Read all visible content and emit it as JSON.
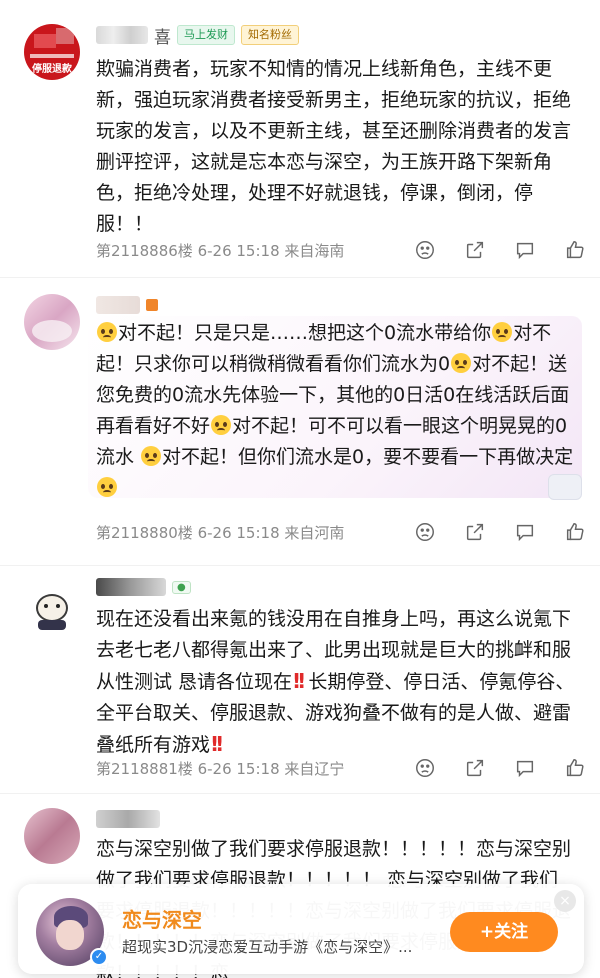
{
  "comments": [
    {
      "name_tail": "喜",
      "badges": [
        "马上发财",
        "知名粉丝"
      ],
      "text": "欺骗消费者，玩家不知情的情况上线新角色，主线不更新，强迫玩家消费者接受新男主，拒绝玩家的抗议，拒绝玩家的发言，以及不更新主线，甚至还删除消费者的发言删评控评，这就是忘本恋与深空，为王族开路下架新角色，拒绝冷处理，处理不好就退钱，停课，倒闭，停服！！",
      "meta": "第2118886楼  6-26 15:18  来自海南",
      "avatar_text": "停服退款"
    },
    {
      "parts": [
        "对不起！只是只是……想把这个0流水带给你",
        "对不起！只求你可以稍微稍微看看你们流水为0",
        "对不起！送您免费的0流水先体验一下，其他的0日活0在线活跃后面再看看好不好",
        "对不起！可不可以看一眼这个明晃晃的0流水 ",
        "对不起！但你们流水是0，要不要看一下再做决定"
      ],
      "meta": "第2118880楼  6-26 15:18  来自河南"
    },
    {
      "text_a": "现在还没看出来氪的钱没用在自推身上吗，再这么说氪下去老七老八都得氪出来了、此男出现就是巨大的挑衅和服从性测试 恳请各位现在",
      "text_b": "长期停登、停日活、停氪停谷、全平台取关、停服退款、游戏狗叠不做有的是人做、避雷叠纸所有游戏",
      "bang": "!!",
      "meta": "第2118881楼  6-26 15:18  来自辽宁"
    },
    {
      "text": "恋与深空别做了我们要求停服退款！！！！！恋与深空别做了我们要求停服退款！！！！！ 恋与深空别做了我们要求停服退款！！！！！恋与深空别做了我们要求停服退款！！！！！恋与深空别做了我们要求停服退款！！！！！恋"
    }
  ],
  "promo": {
    "title": "恋与深空",
    "subtitle": "超现实3D沉浸恋爱互动手游《恋与深空》...",
    "follow_label": "+关注",
    "close_icon": "×"
  },
  "colors": {
    "accent": "#ff8a1f",
    "meta": "#8a8a8a",
    "bang": "#e02a2a"
  }
}
